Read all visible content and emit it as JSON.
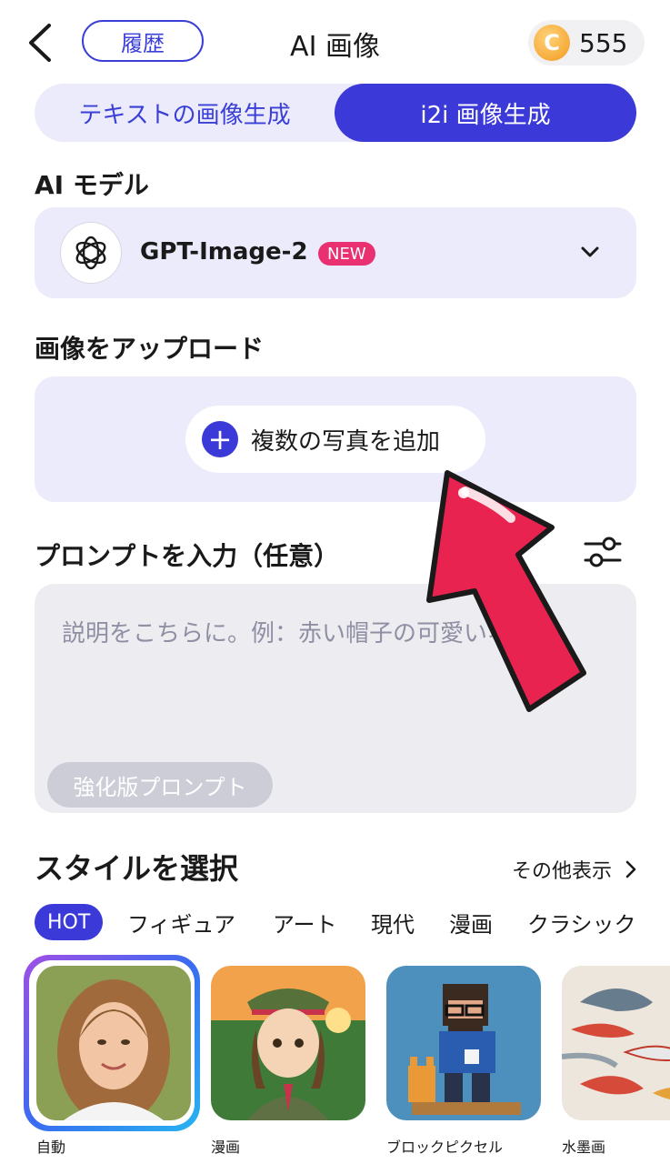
{
  "header": {
    "history_label": "履歴",
    "title": "AI 画像",
    "coins": "555",
    "coin_glyph": "C"
  },
  "mode_tabs": [
    {
      "label": "テキストの画像生成"
    },
    {
      "label": "i2i 画像生成"
    }
  ],
  "model_section": {
    "label": "AI モデル",
    "model_name": "GPT-Image-2",
    "badge": "NEW"
  },
  "upload_section": {
    "label": "画像をアップロード",
    "button_label": "複数の写真を追加"
  },
  "prompt_section": {
    "label": "プロンプトを入力（任意）",
    "placeholder": "説明をこちらに。例：赤い帽子の可愛いネコ",
    "enhance_label": "強化版プロンプト"
  },
  "styles_section": {
    "title": "スタイルを選択",
    "more_label": "その他表示",
    "categories": [
      "HOT",
      "フィギュア",
      "アート",
      "現代",
      "漫画",
      "クラシック"
    ],
    "thumbnails": [
      {
        "label": "自動"
      },
      {
        "label": "漫画"
      },
      {
        "label": "ブロックピクセル"
      },
      {
        "label": "水墨画"
      }
    ]
  },
  "colors": {
    "accent": "#3b39d8",
    "badge": "#e93070",
    "arrow": "#e8234f"
  }
}
